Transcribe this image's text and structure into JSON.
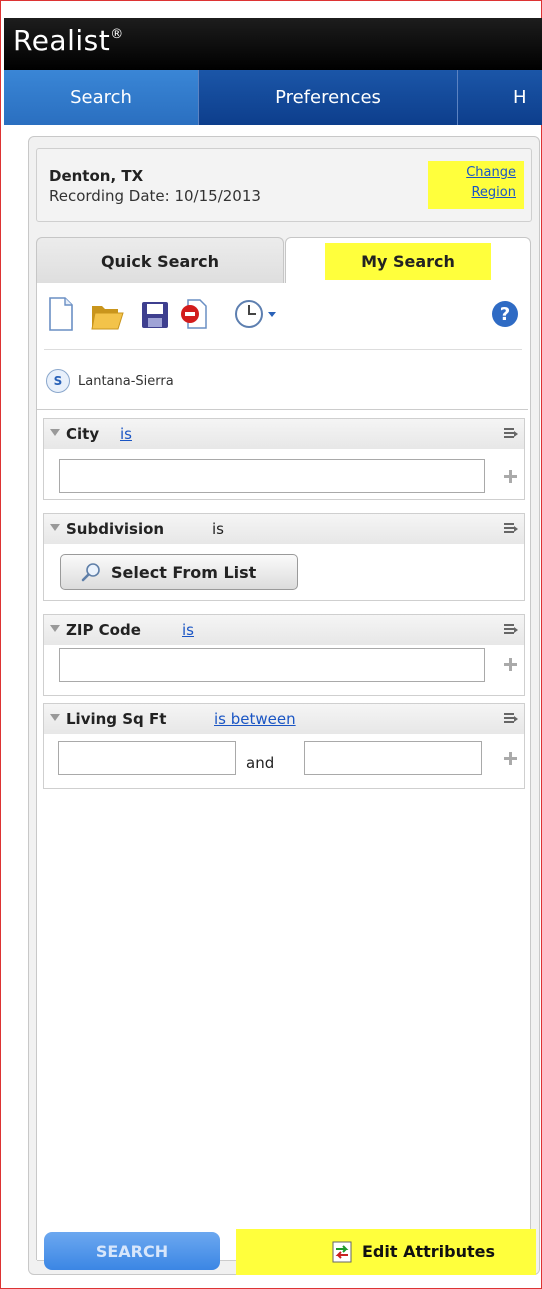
{
  "app": {
    "title": "Realist",
    "trademark": "®"
  },
  "nav": {
    "tabs": [
      {
        "label": "Search"
      },
      {
        "label": "Preferences"
      },
      {
        "label": "H"
      }
    ]
  },
  "region": {
    "name": "Denton, TX",
    "recording_date": "Recording Date: 10/15/2013",
    "change_line1": "Change",
    "change_line2": "Region"
  },
  "tabs": {
    "quick": "Quick Search",
    "my": "My Search"
  },
  "toolbar": {
    "icons": [
      "new-document-icon",
      "open-folder-icon",
      "save-floppy-icon",
      "delete-icon",
      "history-clock-icon",
      "help-icon"
    ]
  },
  "saved_search": {
    "badge": "S",
    "name": "Lantana-Sierra"
  },
  "criteria": [
    {
      "label": "City",
      "operator": "is",
      "value": ""
    },
    {
      "label": "Subdivision",
      "operator": "is",
      "button": "Select From List"
    },
    {
      "label": "ZIP Code",
      "operator": "is",
      "value": ""
    },
    {
      "label": "Living Sq Ft",
      "operator": "is between",
      "and_label": "and",
      "min": "",
      "max": ""
    }
  ],
  "footer": {
    "search_label": "SEARCH",
    "edit_attributes_label": "Edit Attributes"
  },
  "colors": {
    "header": "#000000",
    "nav": "#0b3a84",
    "active_tab": "#2a6fc0",
    "highlight": "#ffff3c",
    "link": "#1a55c4"
  }
}
